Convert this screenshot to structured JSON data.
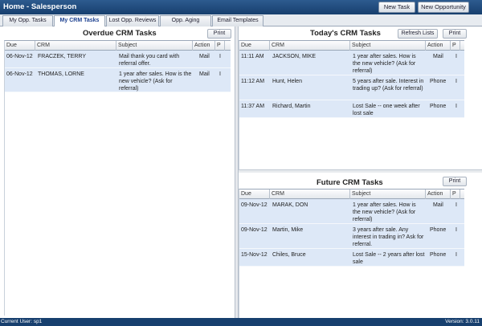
{
  "window": {
    "title": "Home - Salesperson"
  },
  "toolbar": {
    "new_task": "New Task",
    "new_opportunity": "New Opportunity"
  },
  "tabs": [
    {
      "label": "My Opp. Tasks"
    },
    {
      "label": "My CRM Tasks"
    },
    {
      "label": "Lost Opp. Reviews"
    },
    {
      "label": "Opp. Aging"
    },
    {
      "label": "Email Templates"
    }
  ],
  "active_tab": "My CRM Tasks",
  "overdue": {
    "title": "Overdue CRM Tasks",
    "print": "Print",
    "columns": [
      "Due",
      "CRM",
      "Subject",
      "Action",
      "P"
    ],
    "rows": [
      {
        "due": "06-Nov-12",
        "crm": "FRACZEK, TERRY",
        "subject": "Mail thank you card with referral offer.",
        "action": "Mail",
        "p": "I"
      },
      {
        "due": "06-Nov-12",
        "crm": "THOMAS, LORNE",
        "subject": "1 year after sales. How is the new vehicle? (Ask for referral)",
        "action": "Mail",
        "p": "I"
      }
    ]
  },
  "today": {
    "title": "Today's CRM Tasks",
    "refresh": "Refresh Lists",
    "print": "Print",
    "columns": [
      "Due",
      "CRM",
      "Subject",
      "Action",
      "P"
    ],
    "rows": [
      {
        "due": "11:11 AM",
        "crm": "JACKSON, MIKE",
        "subject": "1 year after sales. How is the new vehicle? (Ask for referral)",
        "action": "Mail",
        "p": "I"
      },
      {
        "due": "11:12 AM",
        "crm": "Hunt, Helen",
        "subject": "5 years after sale. Interest in trading up? (Ask for referral)",
        "action": "Phone",
        "p": "I"
      },
      {
        "due": "11:37 AM",
        "crm": "Richard, Martin",
        "subject": "Lost Sale -- one week after lost sale",
        "action": "Phone",
        "p": "I"
      }
    ]
  },
  "future": {
    "title": "Future CRM Tasks",
    "print": "Print",
    "columns": [
      "Due",
      "CRM",
      "Subject",
      "Action",
      "P"
    ],
    "rows": [
      {
        "due": "09-Nov-12",
        "crm": "MARAK, DON",
        "subject": "1 year after sales. How is the new vehicle? (Ask for referral)",
        "action": "Mail",
        "p": "I"
      },
      {
        "due": "09-Nov-12",
        "crm": "Martin, Mike",
        "subject": "3 years after sale. Any interest in trading in? Ask for referral.",
        "action": "Phone",
        "p": "I"
      },
      {
        "due": "15-Nov-12",
        "crm": "Chiles, Bruce",
        "subject": "Lost Sale -- 2 years after lost sale",
        "action": "Phone",
        "p": "I"
      }
    ]
  },
  "status": {
    "user": "Current User: sp1",
    "version": "Version: 3.0.11"
  }
}
